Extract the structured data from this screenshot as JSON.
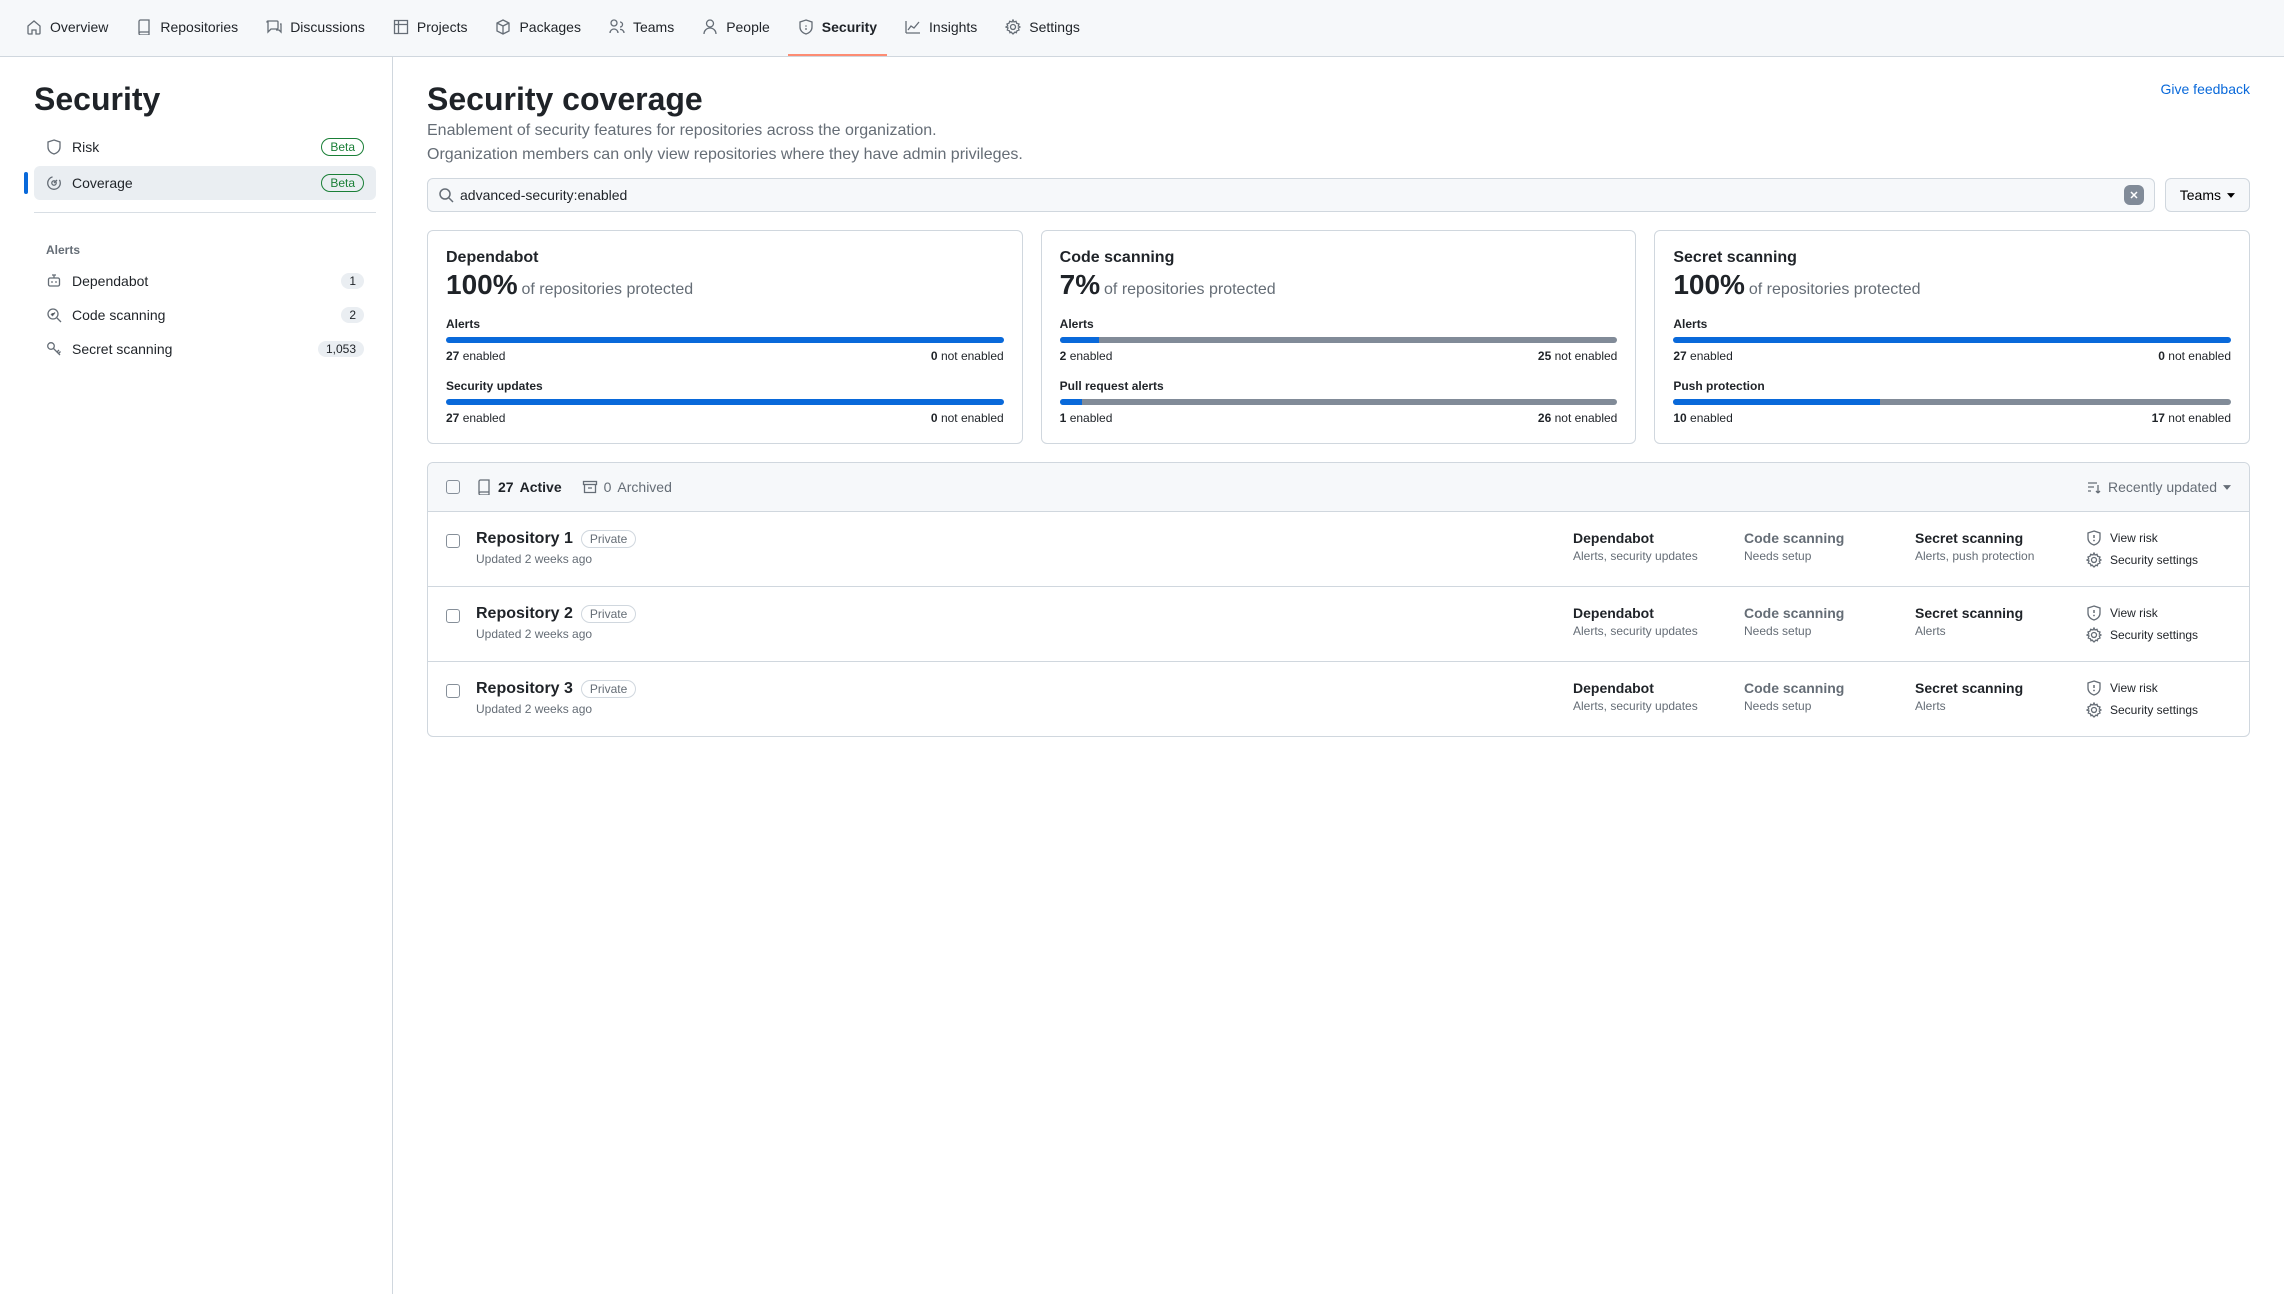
{
  "topnav": [
    {
      "label": "Overview",
      "active": false
    },
    {
      "label": "Repositories",
      "active": false
    },
    {
      "label": "Discussions",
      "active": false
    },
    {
      "label": "Projects",
      "active": false
    },
    {
      "label": "Packages",
      "active": false
    },
    {
      "label": "Teams",
      "active": false
    },
    {
      "label": "People",
      "active": false
    },
    {
      "label": "Security",
      "active": true
    },
    {
      "label": "Insights",
      "active": false
    },
    {
      "label": "Settings",
      "active": false
    }
  ],
  "sidebar": {
    "title": "Security",
    "items": [
      {
        "label": "Risk",
        "badge": "Beta"
      },
      {
        "label": "Coverage",
        "badge": "Beta",
        "active": true
      }
    ],
    "alerts_heading": "Alerts",
    "alerts": [
      {
        "label": "Dependabot",
        "count": "1"
      },
      {
        "label": "Code scanning",
        "count": "2"
      },
      {
        "label": "Secret scanning",
        "count": "1,053"
      }
    ]
  },
  "header": {
    "title": "Security coverage",
    "feedback": "Give feedback",
    "desc": "Enablement of security features for repositories across the organization.",
    "sub": "Organization members can only view repositories where they have admin privileges."
  },
  "search": {
    "value": "advanced-security:enabled"
  },
  "teams_btn": "Teams",
  "cards": [
    {
      "title": "Dependabot",
      "pct": "100%",
      "pct_of": "of repositories protected",
      "sec1": {
        "label": "Alerts",
        "fill": 100,
        "enabled": "27",
        "not": "0"
      },
      "sec2": {
        "label": "Security updates",
        "fill": 100,
        "enabled": "27",
        "not": "0"
      }
    },
    {
      "title": "Code scanning",
      "pct": "7%",
      "pct_of": "of repositories protected",
      "sec1": {
        "label": "Alerts",
        "fill": 7,
        "enabled": "2",
        "not": "25"
      },
      "sec2": {
        "label": "Pull request alerts",
        "fill": 4,
        "enabled": "1",
        "not": "26"
      }
    },
    {
      "title": "Secret scanning",
      "pct": "100%",
      "pct_of": "of repositories protected",
      "sec1": {
        "label": "Alerts",
        "fill": 100,
        "enabled": "27",
        "not": "0"
      },
      "sec2": {
        "label": "Push protection",
        "fill": 37,
        "enabled": "10",
        "not": "17"
      }
    }
  ],
  "repo_tabs": {
    "active": {
      "count": "27",
      "label": "Active"
    },
    "archived": {
      "count": "0",
      "label": "Archived"
    }
  },
  "sort": "Recently updated",
  "enabled_word": "enabled",
  "not_enabled_word": "not enabled",
  "repos": [
    {
      "name": "Repository 1",
      "vis": "Private",
      "updated": "Updated 2 weeks ago",
      "dep": {
        "title": "Dependabot",
        "sub": "Alerts, security updates"
      },
      "code": {
        "title": "Code scanning",
        "sub": "Needs setup",
        "muted": true
      },
      "secret": {
        "title": "Secret scanning",
        "sub": "Alerts, push protection"
      },
      "risk": "View risk",
      "settings": "Security settings"
    },
    {
      "name": "Repository 2",
      "vis": "Private",
      "updated": "Updated 2 weeks ago",
      "dep": {
        "title": "Dependabot",
        "sub": "Alerts, security updates"
      },
      "code": {
        "title": "Code scanning",
        "sub": "Needs setup",
        "muted": true
      },
      "secret": {
        "title": "Secret scanning",
        "sub": "Alerts"
      },
      "risk": "View risk",
      "settings": "Security settings"
    },
    {
      "name": "Repository 3",
      "vis": "Private",
      "updated": "Updated 2 weeks ago",
      "dep": {
        "title": "Dependabot",
        "sub": "Alerts, security updates"
      },
      "code": {
        "title": "Code scanning",
        "sub": "Needs setup",
        "muted": true
      },
      "secret": {
        "title": "Secret scanning",
        "sub": "Alerts"
      },
      "risk": "View risk",
      "settings": "Security settings"
    }
  ]
}
